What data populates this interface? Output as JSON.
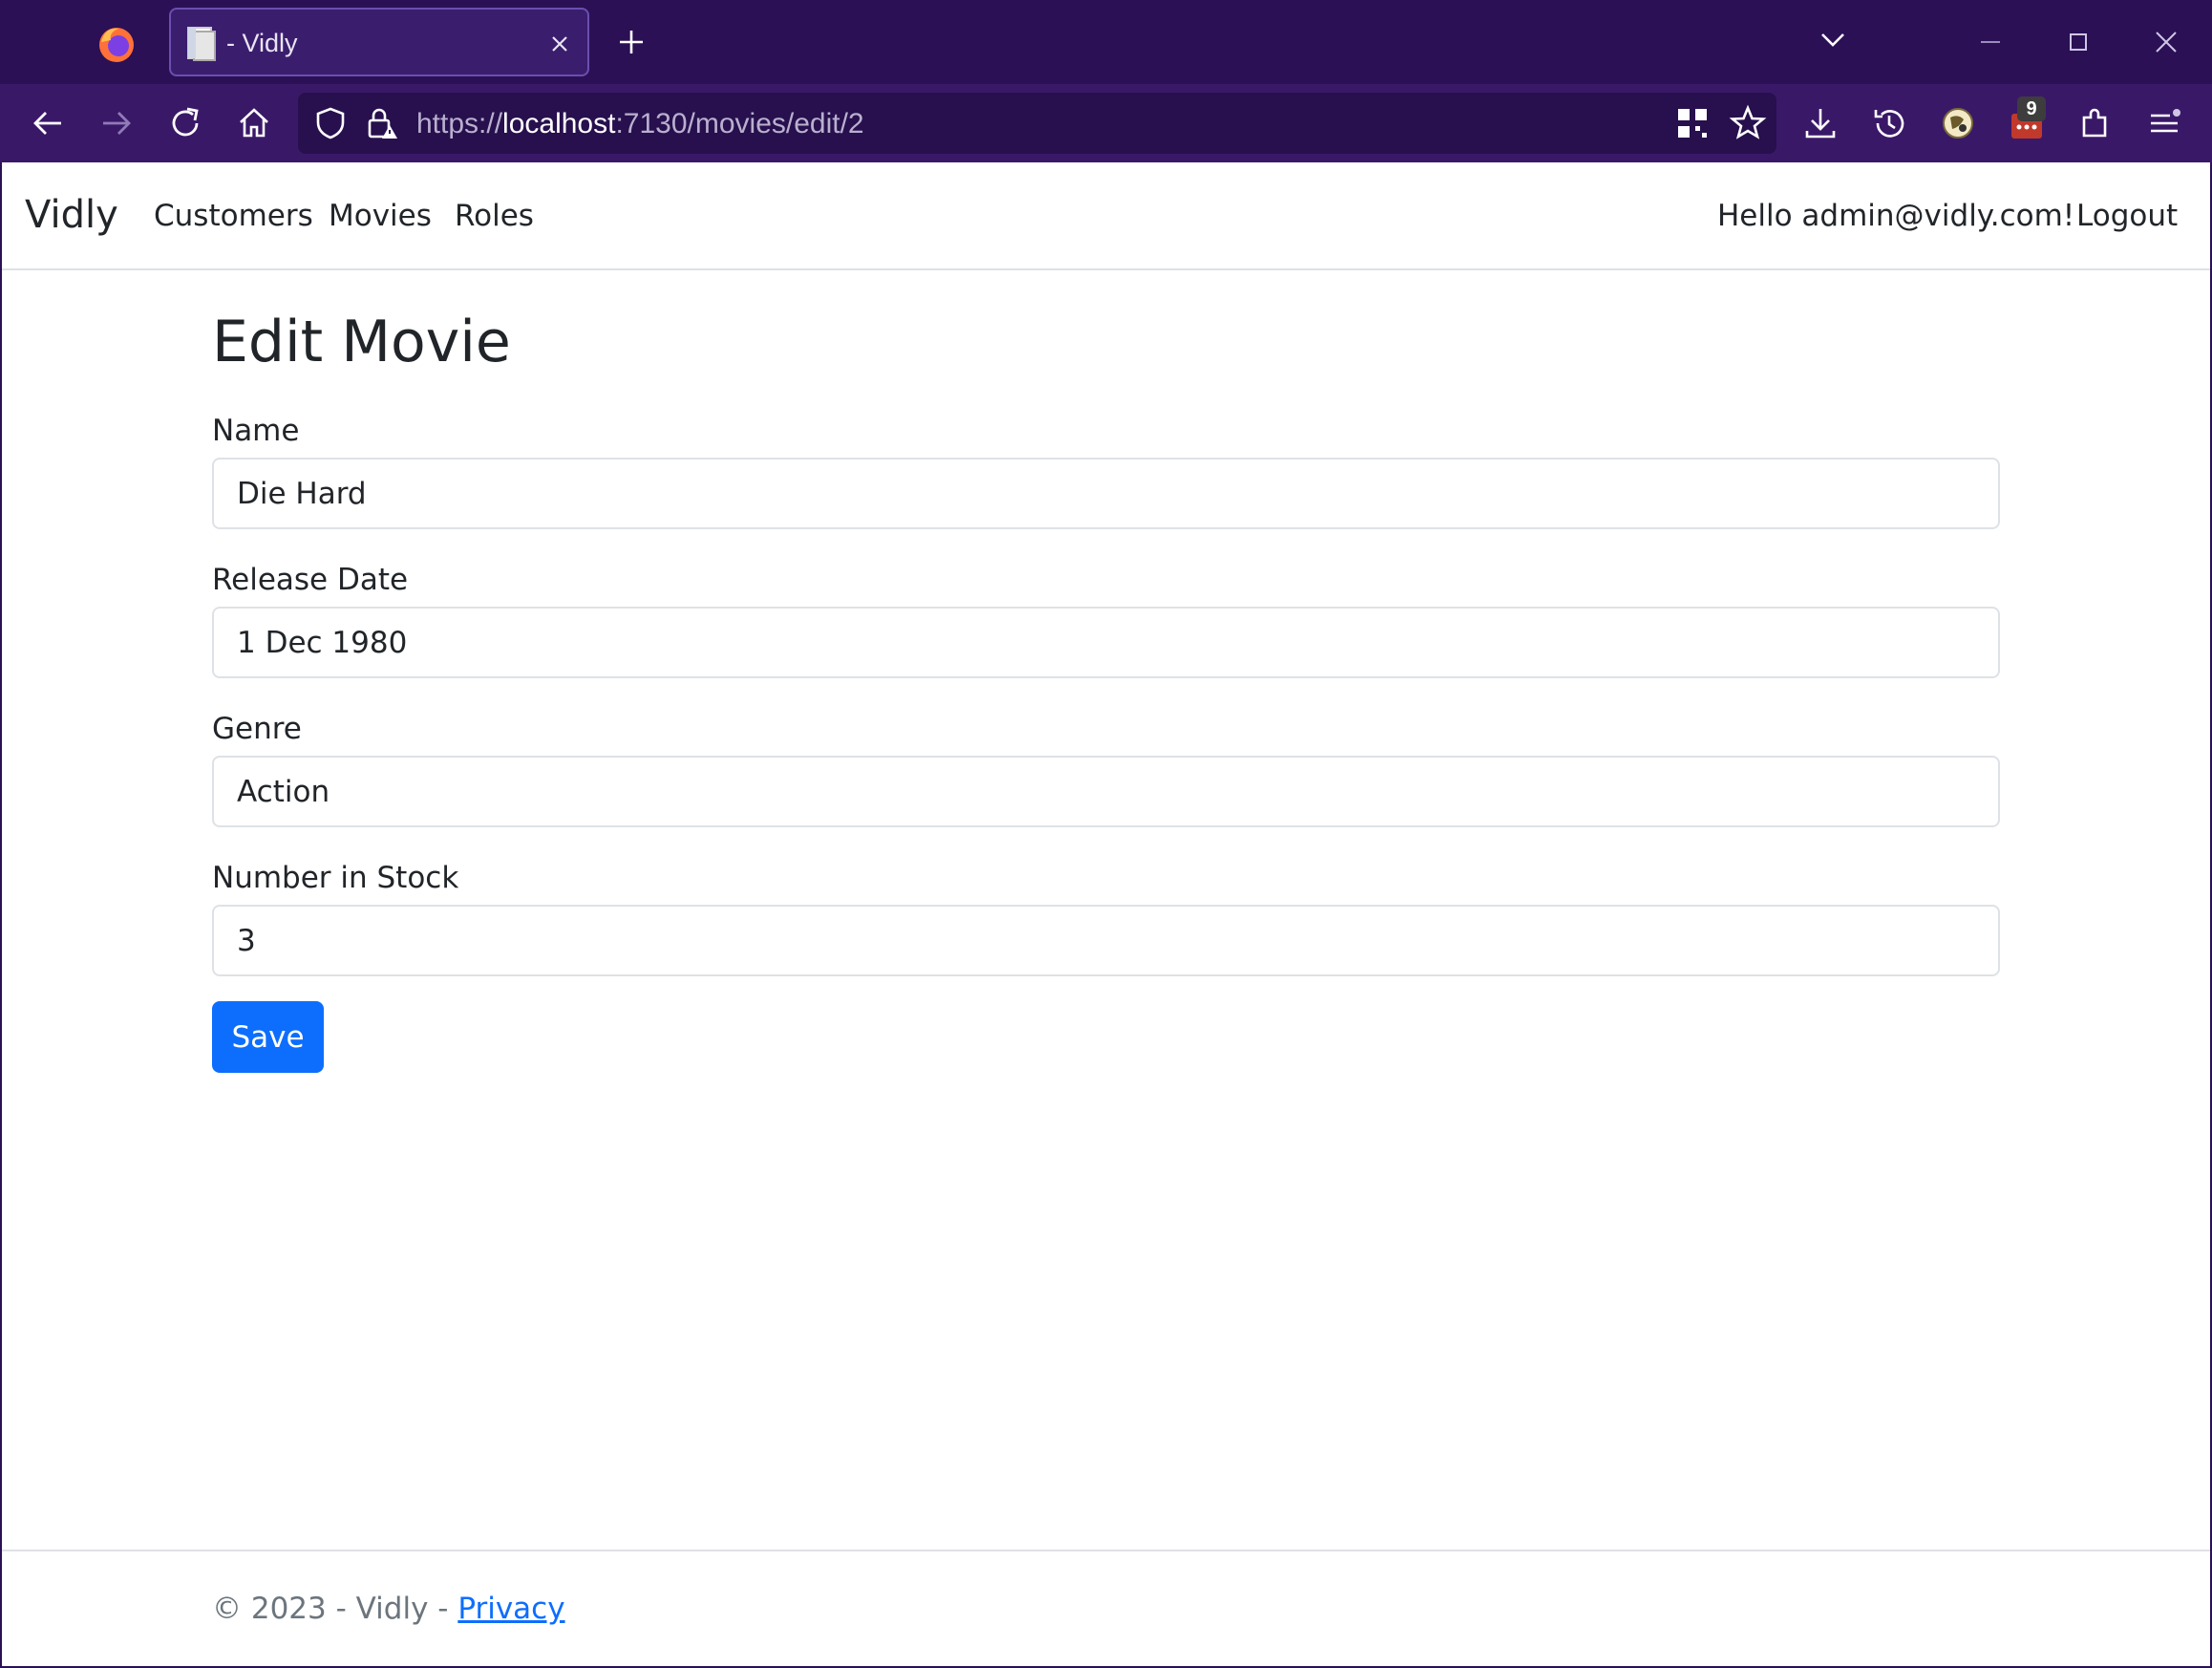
{
  "browser": {
    "tab_title": "- Vidly",
    "url_scheme": "https://",
    "url_host": "localhost",
    "url_path": ":7130/movies/edit/2",
    "extension_badge": "9",
    "colors": {
      "chrome": "#2b1055",
      "toolbar": "#3a1868",
      "urlbar": "#27104d"
    }
  },
  "site": {
    "brand": "Vidly",
    "nav_links": [
      "Customers",
      "Movies",
      "Roles"
    ],
    "greeting": "Hello admin@vidly.com!",
    "logout": "Logout"
  },
  "form": {
    "title": "Edit Movie",
    "name_label": "Name",
    "name_value": "Die Hard",
    "release_label": "Release Date",
    "release_value": "1 Dec 1980",
    "genre_label": "Genre",
    "genre_value": "Action",
    "stock_label": "Number in Stock",
    "stock_value": "3",
    "save_label": "Save",
    "accent": "#0d6efd"
  },
  "footer": {
    "prefix": "© 2023 - Vidly - ",
    "privacy": "Privacy"
  }
}
